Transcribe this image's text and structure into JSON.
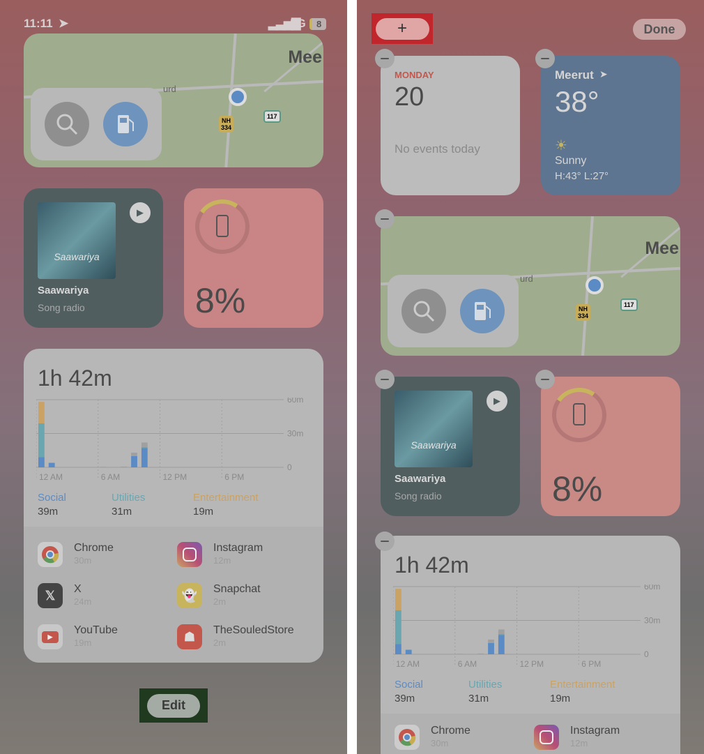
{
  "status": {
    "time": "11:11",
    "network": "5G",
    "battery": "8"
  },
  "map": {
    "city": "Mee",
    "place": "urd",
    "shield_nh": "NH\n334",
    "shield_117": "117"
  },
  "music": {
    "title": "Saawariya",
    "subtitle": "Song radio",
    "art_text": "Saawariya"
  },
  "battery": {
    "percent": "8%",
    "level": 8
  },
  "screen_time": {
    "total": "1h 42m",
    "categories": [
      {
        "name": "Social",
        "value": "39m",
        "color": "#5b8bc4"
      },
      {
        "name": "Utilities",
        "value": "31m",
        "color": "#6aa6b0"
      },
      {
        "name": "Entertainment",
        "value": "19m",
        "color": "#c9a264"
      }
    ],
    "apps": [
      {
        "name": "Chrome",
        "time": "30m"
      },
      {
        "name": "Instagram",
        "time": "12m"
      },
      {
        "name": "X",
        "time": "24m"
      },
      {
        "name": "Snapchat",
        "time": "2m"
      },
      {
        "name": "YouTube",
        "time": "19m"
      },
      {
        "name": "TheSouledStore",
        "time": "2m"
      }
    ]
  },
  "chart_data": {
    "type": "bar",
    "stacked": true,
    "categories": [
      "0",
      "1",
      "2",
      "3",
      "4",
      "5",
      "6",
      "7",
      "8",
      "9",
      "10",
      "11",
      "12",
      "13",
      "14",
      "15",
      "16",
      "17",
      "18",
      "19",
      "20",
      "21",
      "22",
      "23"
    ],
    "x_tick_labels": [
      "12 AM",
      "6 AM",
      "12 PM",
      "6 PM"
    ],
    "y_tick_labels": [
      "60m",
      "30m",
      "0"
    ],
    "ylim": [
      0,
      60
    ],
    "series": [
      {
        "name": "Social",
        "color": "#5b8bc4",
        "values": [
          9,
          4,
          0,
          0,
          0,
          0,
          0,
          0,
          0,
          10,
          17,
          0,
          0,
          0,
          0,
          0,
          0,
          0,
          0,
          0,
          0,
          0,
          0,
          0
        ]
      },
      {
        "name": "Utilities",
        "color": "#6aa6b0",
        "values": [
          30,
          0,
          0,
          0,
          0,
          0,
          0,
          0,
          0,
          0,
          1,
          0,
          0,
          0,
          0,
          0,
          0,
          0,
          0,
          0,
          0,
          0,
          0,
          0
        ]
      },
      {
        "name": "Entertainment",
        "color": "#c9a264",
        "values": [
          19,
          0,
          0,
          0,
          0,
          0,
          0,
          0,
          0,
          0,
          0,
          0,
          0,
          0,
          0,
          0,
          0,
          0,
          0,
          0,
          0,
          0,
          0,
          0
        ]
      },
      {
        "color": "#a0a0a0",
        "values": [
          0,
          0,
          0,
          0,
          0,
          0,
          0.5,
          0,
          0.7,
          3,
          4,
          0,
          0,
          0,
          0,
          0,
          0,
          0,
          0,
          0,
          0,
          0,
          0,
          0
        ]
      }
    ]
  },
  "left": {
    "edit_label": "Edit"
  },
  "right": {
    "add_label": "+",
    "done_label": "Done"
  },
  "calendar": {
    "day": "MONDAY",
    "date": "20",
    "events": "No events today"
  },
  "weather": {
    "city": "Meerut",
    "temp": "38°",
    "condition": "Sunny",
    "hilo": "H:43° L:27°"
  },
  "highlight_colors": {
    "edit": "#1f3a1f",
    "add": "#c0262b"
  }
}
